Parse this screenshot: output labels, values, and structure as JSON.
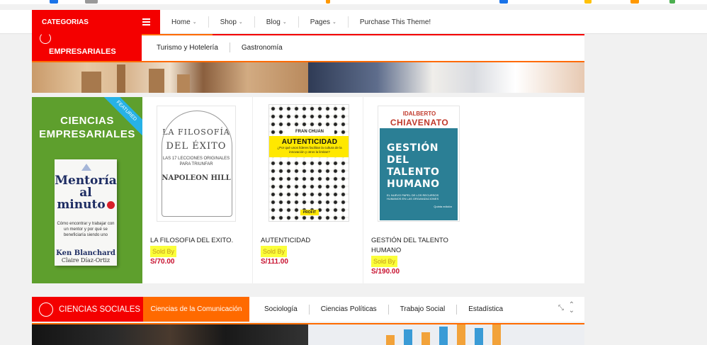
{
  "topnav": {
    "categories_label": "CATEGORIAS",
    "menu": [
      {
        "label": "Home"
      },
      {
        "label": "Shop"
      },
      {
        "label": "Blog"
      },
      {
        "label": "Pages"
      },
      {
        "label": "Purchase This Theme!"
      }
    ],
    "caret": "⌄"
  },
  "section1": {
    "title": "EMPRESARIALES",
    "tabs": [
      "Turismo y Hotelería",
      "Gastronomía"
    ]
  },
  "featured": {
    "title_line1": "CIENCIAS",
    "title_line2": "EMPRESARIALES",
    "ribbon": "FEATURED",
    "book": {
      "title_line1": "Mentoría",
      "title_line2": "al minuto",
      "subtitle": "Cómo encontrar y trabajar con un mentor y por qué se beneficiaría siendo uno",
      "author1": "Ken Blanchard",
      "author2": "Claire Díaz-Ortiz"
    }
  },
  "products": [
    {
      "name": "LA FILOSOFIA DEL EXITO.",
      "sold_by": "Sold By",
      "price": "S/70.00",
      "cover": {
        "line1": "LA FILOSOFÍA",
        "line2": "DEL ÉXITO",
        "line3": "LAS 17 LECCIONES ORIGINALES PARA TRIUNFAR",
        "author": "NAPOLEON HILL"
      }
    },
    {
      "name": "AUTENTICIDAD",
      "sold_by": "Sold By",
      "price": "S/111.00",
      "cover": {
        "author": "FRAN CHUAN",
        "title": "AUTENTICIDAD",
        "subtitle": "¿Por qué unos líderes facilitan la cultura de la innovación y otros la limitan?",
        "publisher": "PROFIT"
      }
    },
    {
      "name": "GESTIÓN DEL TALENTO HUMANO",
      "sold_by": "Sold By",
      "price": "S/190.00",
      "cover": {
        "author_first": "IDALBERTO",
        "author_last": "CHIAVENATO",
        "title_line1": "GESTIÓN",
        "title_line2": "DEL TALENTO",
        "title_line3": "HUMANO",
        "subtitle": "EL NUEVO PAPEL DE LOS RECURSOS HUMANOS EN LAS ORGANIZACIONES",
        "edition": "Quinta edición"
      }
    }
  ],
  "section2": {
    "title": "CIENCIAS SOCIALES",
    "active_tab": "Ciencias de la Comunicación",
    "tabs": [
      "Sociología",
      "Ciencias Políticas",
      "Trabajo Social",
      "Estadística"
    ]
  },
  "colors": {
    "primary_red": "#f40000",
    "accent_orange": "#ff6a00",
    "price_red": "#c8102e",
    "highlight_yellow": "#fbff3a",
    "featured_green": "#5e9f2d",
    "ribbon_blue": "#27b2e6"
  }
}
